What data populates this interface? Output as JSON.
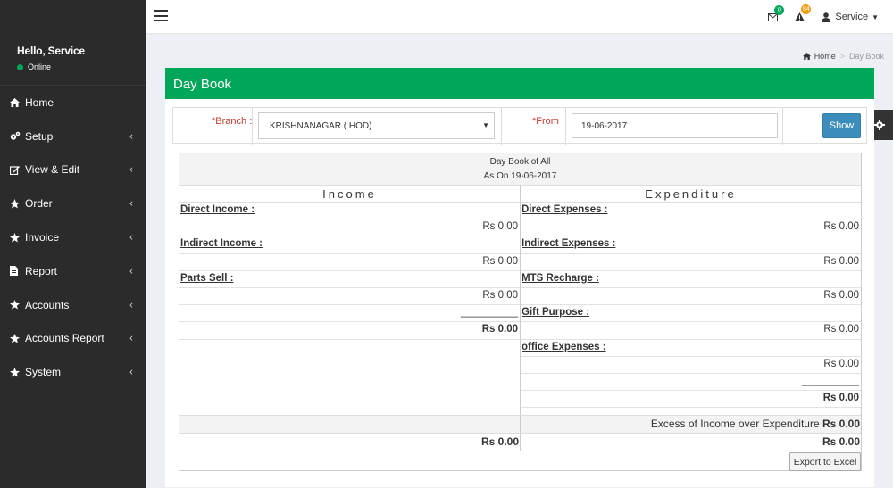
{
  "sidebar": {
    "greeting": "Hello, Service",
    "status": "Online",
    "items": [
      {
        "label": "Home",
        "icon": "home-icon",
        "has_children": false
      },
      {
        "label": "Setup",
        "icon": "cogs-icon",
        "has_children": true
      },
      {
        "label": "View & Edit",
        "icon": "edit-icon",
        "has_children": true
      },
      {
        "label": "Order",
        "icon": "star-icon",
        "has_children": true
      },
      {
        "label": "Invoice",
        "icon": "star-icon",
        "has_children": true
      },
      {
        "label": "Report",
        "icon": "file-icon",
        "has_children": true
      },
      {
        "label": "Accounts",
        "icon": "star-icon",
        "has_children": true
      },
      {
        "label": "Accounts Report",
        "icon": "star-icon",
        "has_children": true
      },
      {
        "label": "System",
        "icon": "star-icon",
        "has_children": true
      }
    ]
  },
  "header": {
    "messages_count": "0",
    "alerts_count": "84",
    "user_label": "Service"
  },
  "breadcrumb": {
    "home": "Home",
    "current": "Day Book"
  },
  "page": {
    "title": "Day Book"
  },
  "filters": {
    "branch_label": "*Branch :",
    "branch_value": "KRISHNANAGAR ( HOD)",
    "from_label": "*From :",
    "from_value": "19-06-2017",
    "show_label": "Show"
  },
  "report": {
    "title": "Day Book of All",
    "subtitle": "As On 19-06-2017",
    "income_header": "Income",
    "expenditure_header": "Expenditure",
    "income_rows": [
      {
        "type": "head",
        "text": "Direct Income :"
      },
      {
        "type": "amt",
        "text": "Rs 0.00"
      },
      {
        "type": "head",
        "text": "Indirect Income :"
      },
      {
        "type": "amt",
        "text": "Rs 0.00"
      },
      {
        "type": "head",
        "text": "Parts Sell :"
      },
      {
        "type": "amt",
        "text": "Rs 0.00"
      },
      {
        "type": "amt",
        "text": "__________"
      },
      {
        "type": "amtbold",
        "text": "Rs 0.00"
      }
    ],
    "expenditure_rows": [
      {
        "type": "head",
        "text": "Direct Expenses :"
      },
      {
        "type": "amt",
        "text": "Rs 0.00"
      },
      {
        "type": "head",
        "text": "Indirect Expenses :"
      },
      {
        "type": "amt",
        "text": "Rs 0.00"
      },
      {
        "type": "head",
        "text": "MTS Recharge :"
      },
      {
        "type": "amt",
        "text": "Rs 0.00"
      },
      {
        "type": "head",
        "text": "Gift Purpose :"
      },
      {
        "type": "amt",
        "text": "Rs 0.00"
      },
      {
        "type": "head",
        "text": "office Expenses :"
      },
      {
        "type": "amt",
        "text": "Rs 0.00"
      },
      {
        "type": "amt",
        "text": "__________"
      },
      {
        "type": "amtbold",
        "text": "Rs 0.00"
      }
    ],
    "excess_label": "Excess of Income over Expenditure",
    "excess_value": "Rs 0.00",
    "income_total": "Rs 0.00",
    "expenditure_total": "Rs 0.00",
    "export_label": "Export to Excel"
  },
  "colors": {
    "sidebar_bg": "#2b2b2b",
    "header_green": "#00a65a",
    "primary_blue": "#3c8dbc",
    "required_red": "#c0392b"
  }
}
